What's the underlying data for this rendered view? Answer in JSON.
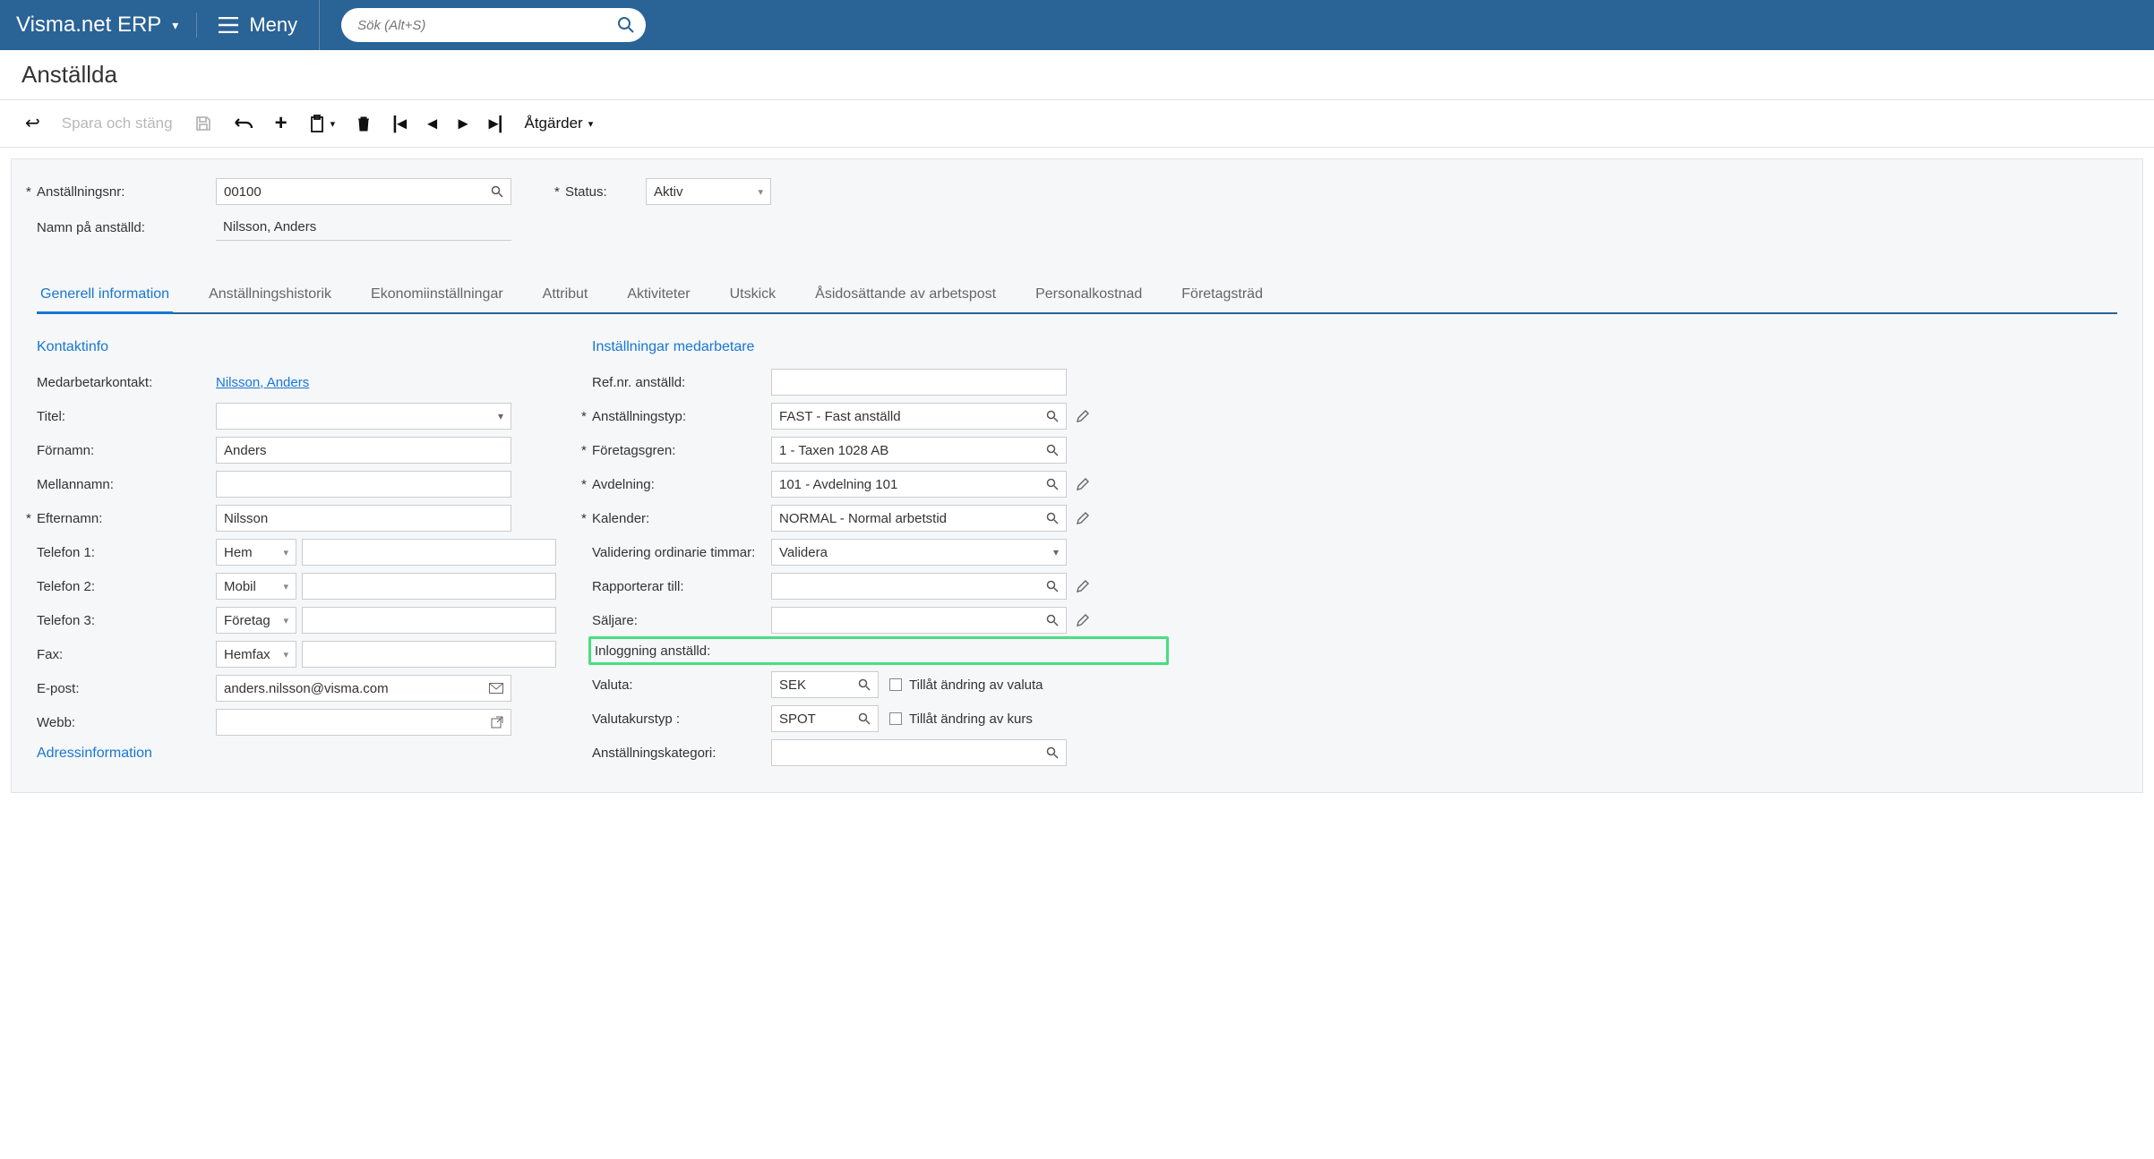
{
  "brand": "Visma.net ERP",
  "menu_label": "Meny",
  "search_placeholder": "Sök (Alt+S)",
  "page_title": "Anställda",
  "toolbar": {
    "save_close": "Spara och stäng",
    "actions": "Åtgärder"
  },
  "header": {
    "emp_no_label": "Anställningsnr:",
    "emp_no_value": "00100",
    "emp_name_label": "Namn på anställd:",
    "emp_name_value": "Nilsson, Anders",
    "status_label": "Status:",
    "status_value": "Aktiv"
  },
  "tabs": [
    "Generell information",
    "Anställningshistorik",
    "Ekonomiinställningar",
    "Attribut",
    "Aktiviteter",
    "Utskick",
    "Åsidosättande av arbetspost",
    "Personalkostnad",
    "Företagsträd"
  ],
  "contact": {
    "section": "Kontaktinfo",
    "contact_label": "Medarbetarkontakt:",
    "contact_link": "Nilsson, Anders",
    "title_label": "Titel:",
    "title_value": "",
    "first_label": "Förnamn:",
    "first_value": "Anders",
    "mid_label": "Mellannamn:",
    "mid_value": "",
    "last_label": "Efternamn:",
    "last_value": "Nilsson",
    "phone1_label": "Telefon 1:",
    "phone1_type": "Hem",
    "phone1_value": "",
    "phone2_label": "Telefon 2:",
    "phone2_type": "Mobil",
    "phone2_value": "",
    "phone3_label": "Telefon 3:",
    "phone3_type": "Företag",
    "phone3_value": "",
    "fax_label": "Fax:",
    "fax_type": "Hemfax",
    "fax_value": "",
    "email_label": "E-post:",
    "email_value": "anders.nilsson@visma.com",
    "web_label": "Webb:",
    "web_value": "",
    "address_section": "Adressinformation"
  },
  "settings": {
    "section": "Inställningar medarbetare",
    "ref_label": "Ref.nr. anställd:",
    "ref_value": "",
    "emptype_label": "Anställningstyp:",
    "emptype_value": "FAST - Fast anställd",
    "branch_label": "Företagsgren:",
    "branch_value": "1 - Taxen 1028 AB",
    "dept_label": "Avdelning:",
    "dept_value": "101 - Avdelning 101",
    "cal_label": "Kalender:",
    "cal_value": "NORMAL - Normal arbetstid",
    "val_label": "Validering ordinarie timmar:",
    "val_value": "Validera",
    "reports_label": "Rapporterar till:",
    "reports_value": "",
    "sales_label": "Säljare:",
    "sales_value": "",
    "login_label": "Inloggning anställd:",
    "login_value": "",
    "curr_label": "Valuta:",
    "curr_value": "SEK",
    "curr_chk": "Tillåt ändring av valuta",
    "rate_label": "Valutakurstyp :",
    "rate_value": "SPOT",
    "rate_chk": "Tillåt ändring av kurs",
    "cat_label": "Anställningskategori:",
    "cat_value": ""
  }
}
